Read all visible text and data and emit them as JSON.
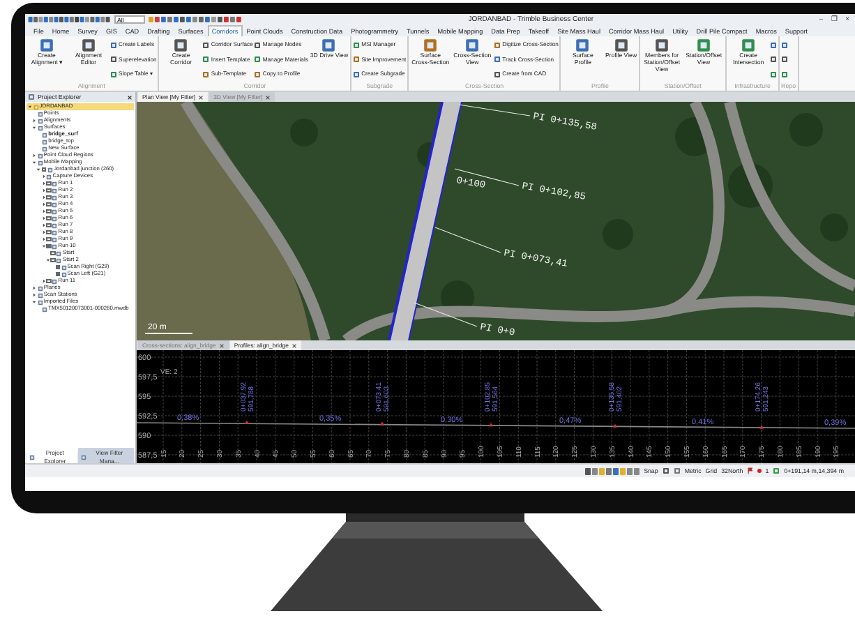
{
  "window": {
    "title": "JORDANBAD - Trimble Business Center",
    "quick_search": {
      "value": "All"
    },
    "window_buttons": [
      "–",
      "❐",
      "×"
    ]
  },
  "menu_tabs": [
    {
      "label": "File",
      "selected": false
    },
    {
      "label": "Home",
      "selected": false
    },
    {
      "label": "Survey",
      "selected": false
    },
    {
      "label": "GIS",
      "selected": false
    },
    {
      "label": "CAD",
      "selected": false
    },
    {
      "label": "Drafting",
      "selected": false
    },
    {
      "label": "Surfaces",
      "selected": false
    },
    {
      "label": "Corridors",
      "selected": true
    },
    {
      "label": "Point Clouds",
      "selected": false
    },
    {
      "label": "Construction Data",
      "selected": false
    },
    {
      "label": "Photogrammetry",
      "selected": false
    },
    {
      "label": "Tunnels",
      "selected": false
    },
    {
      "label": "Mobile Mapping",
      "selected": false
    },
    {
      "label": "Data Prep",
      "selected": false
    },
    {
      "label": "Takeoff",
      "selected": false
    },
    {
      "label": "Site Mass Haul",
      "selected": false
    },
    {
      "label": "Corridor Mass Haul",
      "selected": false
    },
    {
      "label": "Utility",
      "selected": false
    },
    {
      "label": "Drill Pile Compact",
      "selected": false
    },
    {
      "label": "Macros",
      "selected": false
    },
    {
      "label": "Support",
      "selected": false
    }
  ],
  "ribbon": [
    {
      "title": "Alignment",
      "controls": [
        {
          "kind": "large",
          "label": "Create Alignment ▾"
        },
        {
          "kind": "large",
          "label": "Alignment Editor"
        },
        {
          "kind": "stack",
          "items": [
            "Create Labels",
            "Superelevation",
            "Slope Table ▾"
          ]
        }
      ]
    },
    {
      "title": "Corridor",
      "controls": [
        {
          "kind": "large",
          "label": "Create Corridor"
        },
        {
          "kind": "stack",
          "items": [
            "Corridor Surface",
            "Insert Template",
            "Sub-Template"
          ]
        },
        {
          "kind": "stack",
          "items": [
            "Manage Nodes",
            "Manage Materials",
            "Copy to Profile"
          ]
        },
        {
          "kind": "large",
          "label": "3D Drive View"
        }
      ]
    },
    {
      "title": "Subgrade",
      "controls": [
        {
          "kind": "stack",
          "items": [
            "MSI Manager",
            "Site Improvement",
            "Create Subgrade"
          ]
        }
      ]
    },
    {
      "title": "Cross-Section",
      "controls": [
        {
          "kind": "large",
          "label": "Surface Cross-Section"
        },
        {
          "kind": "large",
          "label": "Cross-Section View"
        },
        {
          "kind": "stack",
          "items": [
            "Digitize Cross-Section",
            "Track Cross-Section",
            "Create from CAD"
          ]
        }
      ]
    },
    {
      "title": "Profile",
      "controls": [
        {
          "kind": "large",
          "label": "Surface Profile"
        },
        {
          "kind": "large",
          "label": "Profile View"
        }
      ]
    },
    {
      "title": "Station/Offset",
      "controls": [
        {
          "kind": "large",
          "label": "Members for Station/Offset View"
        },
        {
          "kind": "large",
          "label": "Station/Offset View"
        }
      ]
    },
    {
      "title": "Infrastructure",
      "controls": [
        {
          "kind": "large",
          "label": "Create Intersection"
        },
        {
          "kind": "icons"
        }
      ]
    },
    {
      "title": "Repo",
      "controls": [
        {
          "kind": "icons"
        }
      ]
    }
  ],
  "project_explorer": {
    "title": "Project Explorer",
    "tree": [
      {
        "label": "JORDANBAD",
        "selected": true,
        "expanded": true,
        "children": [
          {
            "label": "Points",
            "selected": false
          },
          {
            "label": "Alignments",
            "selected": false,
            "expanded": false
          },
          {
            "label": "Surfaces",
            "selected": false,
            "expanded": true,
            "children": [
              {
                "label": "bridge_surf",
                "selected": false,
                "current": true
              },
              {
                "label": "bridge_top",
                "selected": false,
                "current": false
              },
              {
                "label": "New Surface",
                "selected": false,
                "current": false
              }
            ]
          },
          {
            "label": "Point Cloud Regions",
            "selected": false,
            "expanded": false
          },
          {
            "label": "Mobile Mapping",
            "selected": false,
            "expanded": true,
            "children": [
              {
                "label": "Jordanbad junction (260)",
                "selected": false,
                "expanded": true,
                "checked": false,
                "children": [
                  {
                    "label": "Capture Devices",
                    "selected": false,
                    "expanded": false
                  },
                  {
                    "label": "Run 1",
                    "selected": false,
                    "expanded": false,
                    "checked": false
                  },
                  {
                    "label": "Run 2",
                    "selected": false,
                    "expanded": false,
                    "checked": false
                  },
                  {
                    "label": "Run 3",
                    "selected": false,
                    "expanded": false,
                    "checked": false
                  },
                  {
                    "label": "Run 4",
                    "selected": false,
                    "expanded": false,
                    "checked": false
                  },
                  {
                    "label": "Run 5",
                    "selected": false,
                    "expanded": false,
                    "checked": false
                  },
                  {
                    "label": "Run 6",
                    "selected": false,
                    "expanded": false,
                    "checked": false
                  },
                  {
                    "label": "Run 7",
                    "selected": false,
                    "expanded": false,
                    "checked": false
                  },
                  {
                    "label": "Run 8",
                    "selected": false,
                    "expanded": false,
                    "checked": false
                  },
                  {
                    "label": "Run 9",
                    "selected": false,
                    "expanded": false,
                    "checked": false
                  },
                  {
                    "label": "Run 10",
                    "selected": false,
                    "expanded": true,
                    "checked": true,
                    "children": [
                      {
                        "label": "Start",
                        "selected": false,
                        "checked": false
                      },
                      {
                        "label": "Start 2",
                        "selected": false,
                        "expanded": true,
                        "checked": false,
                        "children": [
                          {
                            "label": "Scan Right (G29)",
                            "selected": false,
                            "checked": true
                          },
                          {
                            "label": "Scan Left (G21)",
                            "selected": false,
                            "checked": true
                          }
                        ]
                      }
                    ]
                  },
                  {
                    "label": "Run 11",
                    "selected": false,
                    "expanded": false,
                    "checked": false
                  }
                ]
              }
            ]
          },
          {
            "label": "Planes",
            "selected": false,
            "expanded": false
          },
          {
            "label": "Scan Stations",
            "selected": false,
            "expanded": false
          },
          {
            "label": "Imported Files",
            "selected": false,
            "expanded": true,
            "children": [
              {
                "label": "TMX50120073001-000260.mwdb",
                "selected": false
              }
            ]
          }
        ]
      }
    ],
    "bottom_tabs": [
      {
        "label": "Project Explorer",
        "selected": true
      },
      {
        "label": "View Filter Mana...",
        "selected": false
      }
    ]
  },
  "plan_view": {
    "tabs": [
      {
        "label": "Plan View [My Filter]",
        "selected": true
      },
      {
        "label": "3D View [My Filter]",
        "selected": false
      }
    ],
    "labels": [
      "PI 0+135,58",
      "0+100",
      "PI 0+102,85",
      "PI 0+073,41",
      "PI 0+0"
    ],
    "scale": "20 m"
  },
  "profile_view": {
    "tabs": [
      {
        "label": "Cross-sections: align_bridge",
        "selected": false
      },
      {
        "label": "Profiles: align_bridge",
        "selected": true
      }
    ],
    "elevations": [
      "600",
      "597,5",
      "595",
      "592,5",
      "590",
      "587,5"
    ],
    "exaggeration": "VE: 2",
    "stations": [
      {
        "station": "0+037,92",
        "elevation": "591,788"
      },
      {
        "station": "0+073,41",
        "elevation": "591,603"
      },
      {
        "station": "0+102,85",
        "elevation": "591,564"
      },
      {
        "station": "0+135,58",
        "elevation": "591,402"
      },
      {
        "station": "0+174,26",
        "elevation": "591,243"
      }
    ],
    "grades": [
      "0,38%",
      "0,35%",
      "0,30%",
      "0,47%",
      "0,41%",
      "0,39%"
    ],
    "distances": [
      "15",
      "20",
      "25",
      "30",
      "35",
      "40",
      "45",
      "50",
      "55",
      "60",
      "65",
      "70",
      "75",
      "80",
      "85",
      "90",
      "95",
      "100",
      "105",
      "110",
      "115",
      "120",
      "125",
      "130",
      "135",
      "140",
      "145",
      "150",
      "155",
      "160",
      "165",
      "170",
      "175",
      "180",
      "185",
      "190",
      "195"
    ]
  },
  "status_bar": {
    "snap": "Snap",
    "units": "Metric",
    "grid": "Grid",
    "zone": "32North",
    "count": "1",
    "coordinates": "0+191,14 m,14,394 m"
  }
}
